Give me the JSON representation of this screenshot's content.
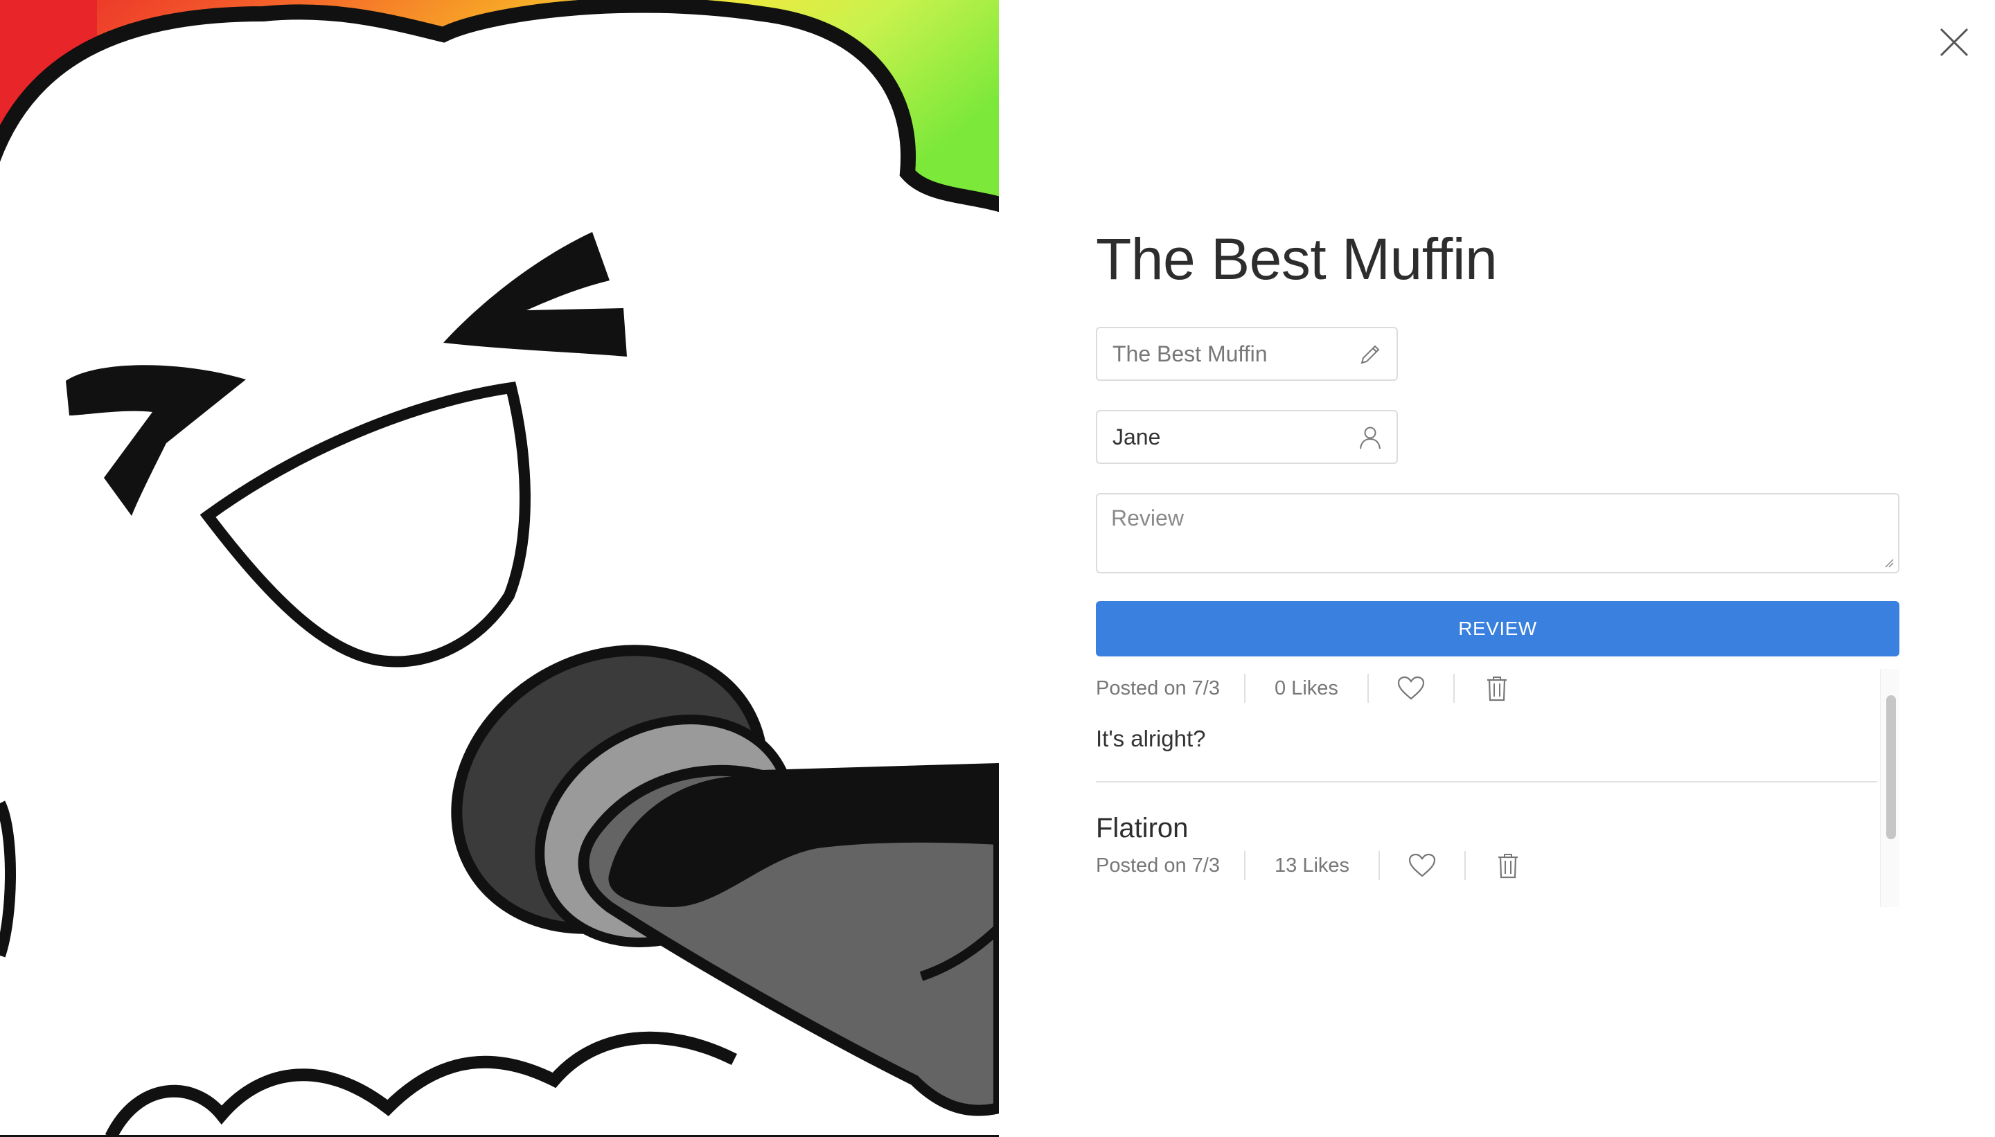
{
  "product": {
    "title": "The Best Muffin"
  },
  "form": {
    "name_value": "The Best Muffin",
    "author_value": "Jane",
    "review_placeholder": "Review",
    "submit_label": "REVIEW"
  },
  "reviews": [
    {
      "reviewer": "",
      "posted": "Posted on 7/3",
      "likes": "0 Likes",
      "text": "It's alright?"
    },
    {
      "reviewer": "Flatiron",
      "posted": "Posted on 7/3",
      "likes": "13 Likes",
      "text": ""
    }
  ],
  "icons": {
    "close": "close-icon",
    "edit": "pencil-icon",
    "user": "user-icon",
    "like": "heart-icon",
    "delete": "trash-icon"
  },
  "colors": {
    "accent": "#3a80df",
    "text": "#2d2d2d",
    "muted": "#777777",
    "border": "#dcdcdc"
  }
}
